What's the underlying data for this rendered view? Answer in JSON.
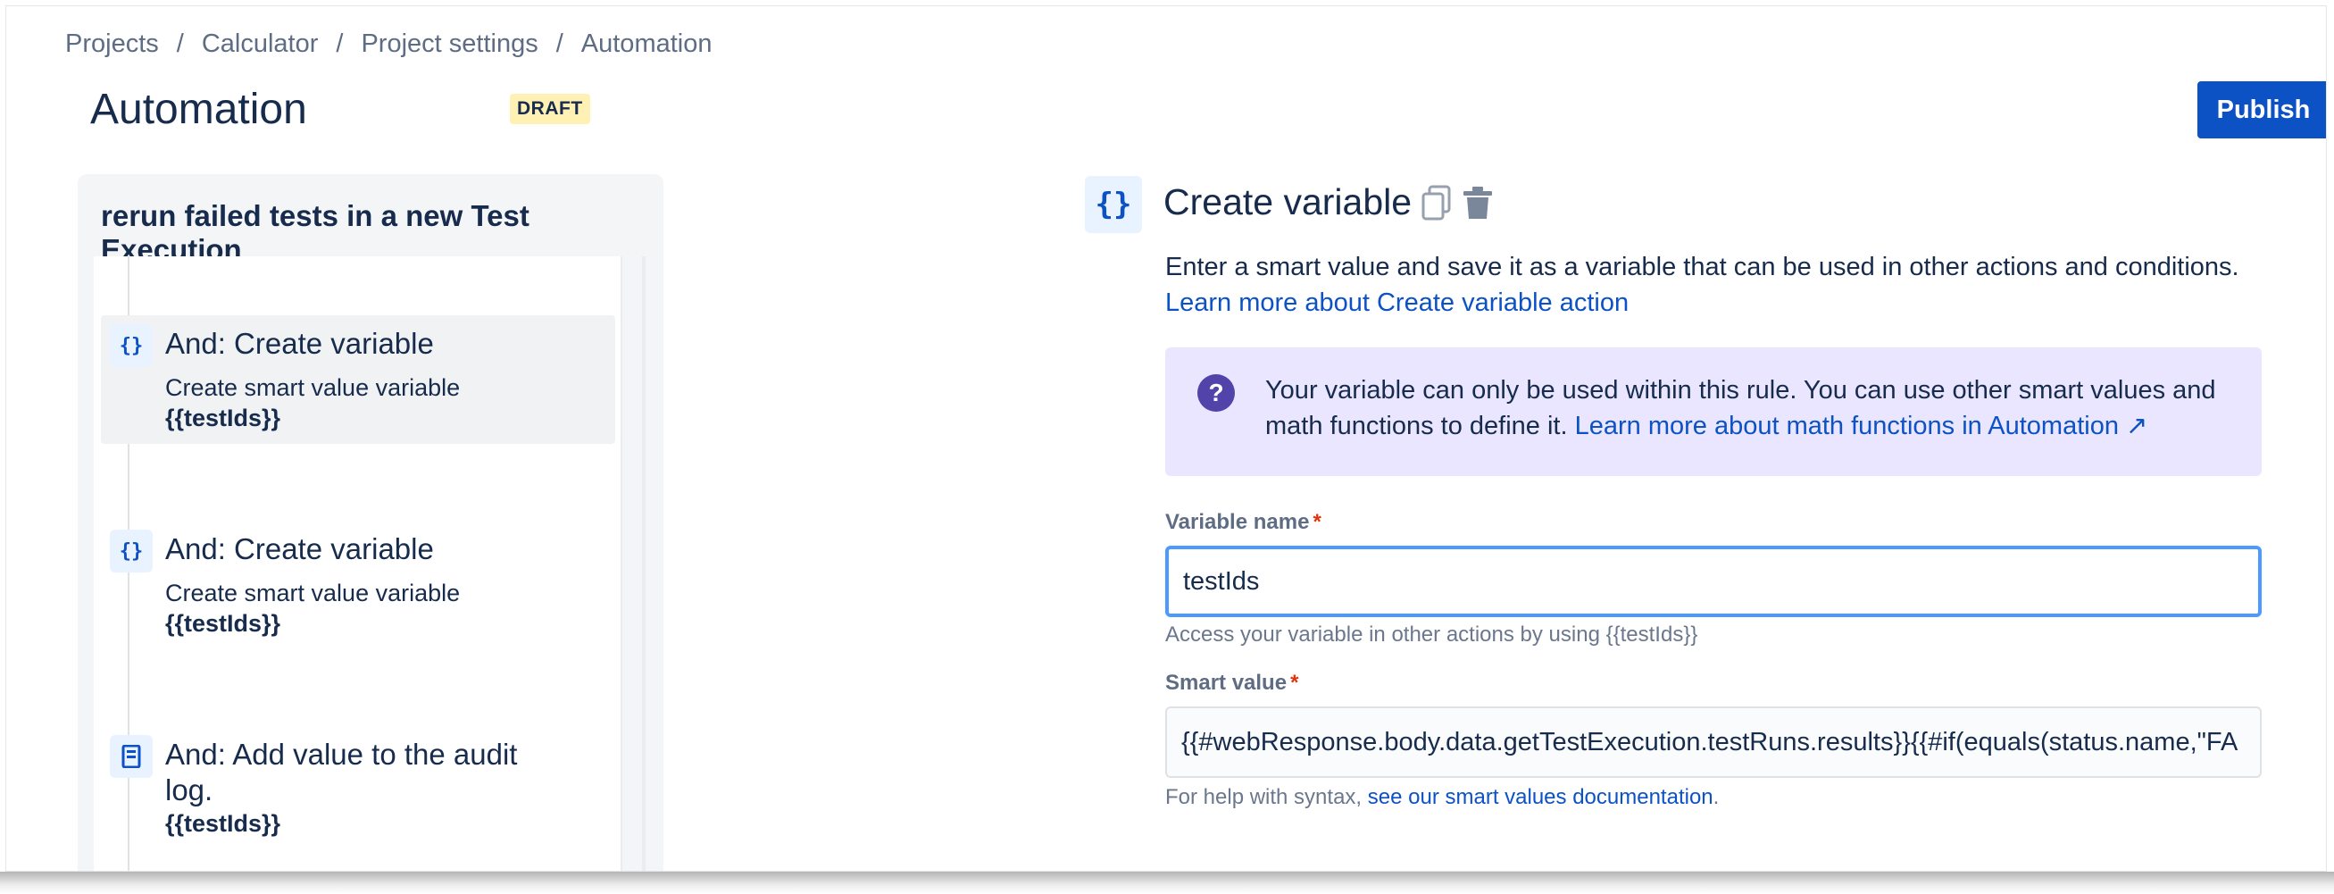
{
  "breadcrumb": {
    "items": [
      "Projects",
      "Calculator",
      "Project settings",
      "Automation"
    ],
    "separator": "/"
  },
  "header": {
    "title": "Automation",
    "status_badge": "DRAFT",
    "publish_label": "Publish"
  },
  "rule": {
    "name": "rerun failed tests in a new Test Execution",
    "steps": [
      {
        "icon": "braces-icon",
        "icon_glyph": "{}",
        "title": "And: Create variable",
        "subtitle": "Create smart value variable",
        "value": "{{testIds}}",
        "selected": true
      },
      {
        "icon": "braces-icon",
        "icon_glyph": "{}",
        "title": "And: Create variable",
        "subtitle": "Create smart value variable",
        "value": "{{testIds}}",
        "selected": false
      },
      {
        "icon": "audit-log-icon",
        "title_line1": "And: Add value to the audit",
        "title_line2": "log.",
        "value": "{{testIds}}",
        "selected": false
      }
    ]
  },
  "detail": {
    "icon_glyph": "{}",
    "title": "Create variable",
    "description": "Enter a smart value and save it as a variable that can be used in other actions and conditions.",
    "learn_more": "Learn more about Create variable action",
    "info": {
      "text": "Your variable can only be used within this rule. You can use other smart values and math functions to define it.",
      "link": "Learn more about math functions in Automation ↗"
    },
    "variable_name": {
      "label": "Variable name",
      "required_mark": "*",
      "value": "testIds",
      "helper": "Access your variable in other actions by using {{testIds}}"
    },
    "smart_value": {
      "label": "Smart value",
      "required_mark": "*",
      "value": "{{#webResponse.body.data.getTestExecution.testRuns.results}}{{#if(equals(status.name,\"FA",
      "helper_prefix": "For help with syntax,",
      "helper_link": "see our smart values documentation",
      "helper_suffix": "."
    }
  },
  "colors": {
    "primary": "#0c52c4",
    "badge_bg": "#fff0b3",
    "info_bg": "#eae6ff",
    "info_icon": "#5243aa",
    "focus_border": "#4c9aff",
    "required": "#de350b"
  }
}
